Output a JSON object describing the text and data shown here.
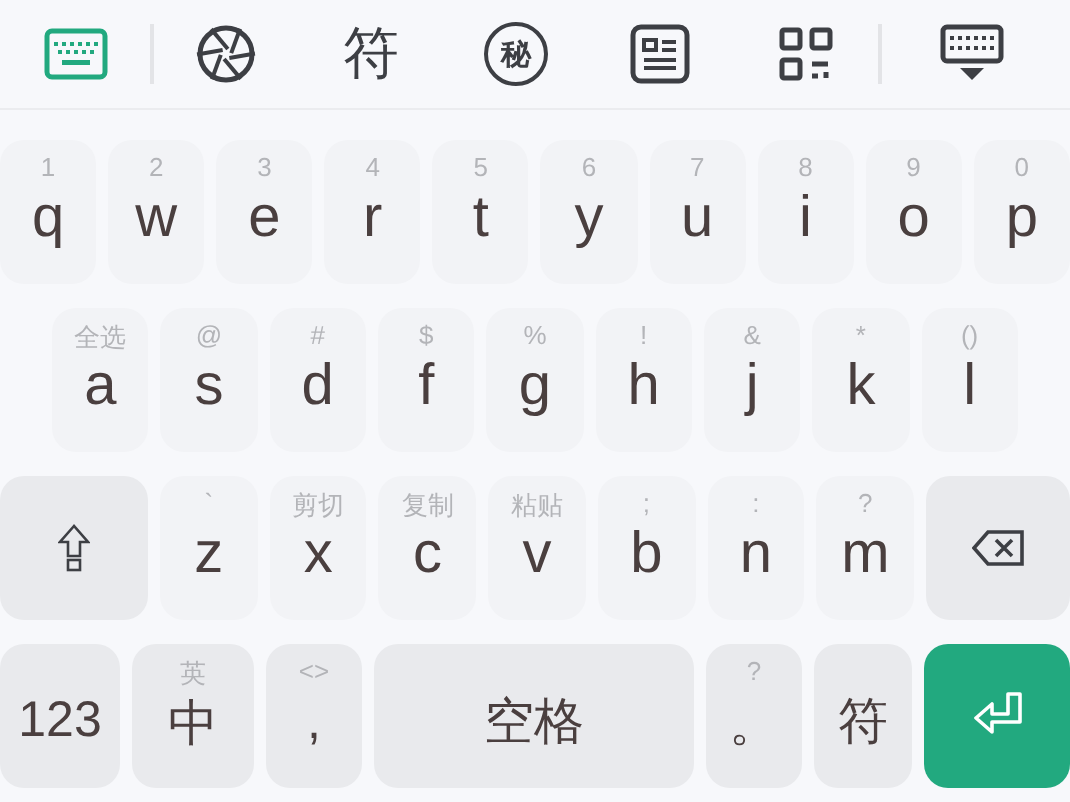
{
  "toolbar": {
    "items": [
      {
        "kind": "keyboard",
        "selected": true
      },
      {
        "kind": "divider"
      },
      {
        "kind": "aperture",
        "selected": false
      },
      {
        "kind": "text",
        "label": "符",
        "selected": false
      },
      {
        "kind": "circled",
        "label": "秘",
        "selected": false
      },
      {
        "kind": "article",
        "selected": false
      },
      {
        "kind": "grid",
        "selected": false
      },
      {
        "kind": "divider"
      },
      {
        "kind": "hide",
        "selected": false
      }
    ]
  },
  "rows": [
    {
      "keys": [
        {
          "kind": "letter",
          "hint": "1",
          "label": "q"
        },
        {
          "kind": "letter",
          "hint": "2",
          "label": "w"
        },
        {
          "kind": "letter",
          "hint": "3",
          "label": "e"
        },
        {
          "kind": "letter",
          "hint": "4",
          "label": "r"
        },
        {
          "kind": "letter",
          "hint": "5",
          "label": "t"
        },
        {
          "kind": "letter",
          "hint": "6",
          "label": "y"
        },
        {
          "kind": "letter",
          "hint": "7",
          "label": "u"
        },
        {
          "kind": "letter",
          "hint": "8",
          "label": "i"
        },
        {
          "kind": "letter",
          "hint": "9",
          "label": "o"
        },
        {
          "kind": "letter",
          "hint": "0",
          "label": "p"
        }
      ]
    },
    {
      "keys": [
        {
          "kind": "letter",
          "hint": "全选",
          "label": "a"
        },
        {
          "kind": "letter",
          "hint": "@",
          "label": "s"
        },
        {
          "kind": "letter",
          "hint": "#",
          "label": "d"
        },
        {
          "kind": "letter",
          "hint": "$",
          "label": "f"
        },
        {
          "kind": "letter",
          "hint": "%",
          "label": "g"
        },
        {
          "kind": "letter",
          "hint": "!",
          "label": "h"
        },
        {
          "kind": "letter",
          "hint": "&",
          "label": "j"
        },
        {
          "kind": "letter",
          "hint": "*",
          "label": "k"
        },
        {
          "kind": "letter",
          "hint": "()",
          "label": "l"
        }
      ]
    },
    {
      "keys": [
        {
          "kind": "shift"
        },
        {
          "kind": "letter",
          "hint": "`",
          "label": "z"
        },
        {
          "kind": "letter",
          "hint": "剪切",
          "label": "x"
        },
        {
          "kind": "letter",
          "hint": "复制",
          "label": "c"
        },
        {
          "kind": "letter",
          "hint": "粘贴",
          "label": "v"
        },
        {
          "kind": "letter",
          "hint": ";",
          "label": "b"
        },
        {
          "kind": "letter",
          "hint": ":",
          "label": "n"
        },
        {
          "kind": "letter",
          "hint": "?",
          "label": "m"
        },
        {
          "kind": "backspace"
        }
      ]
    },
    {
      "keys": [
        {
          "kind": "function",
          "label": "123"
        },
        {
          "kind": "function",
          "hint": "英",
          "label": "中"
        },
        {
          "kind": "function",
          "hint": "<>",
          "label": ","
        },
        {
          "kind": "space",
          "label": "空格"
        },
        {
          "kind": "function",
          "hint": "?",
          "label": "。"
        },
        {
          "kind": "function",
          "label": "符"
        },
        {
          "kind": "enter"
        }
      ]
    }
  ]
}
